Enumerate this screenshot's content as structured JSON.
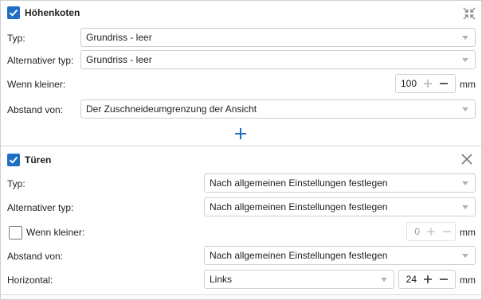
{
  "sections": [
    {
      "title": "Höhenkoten",
      "enabled": true,
      "header_icon": "collapse-icon",
      "typ": {
        "label": "Typ:",
        "value": "Grundriss - leer"
      },
      "alt_typ": {
        "label": "Alternativer typ:",
        "value": "Grundriss - leer"
      },
      "wenn_kleiner": {
        "label": "Wenn kleiner:",
        "value": "100",
        "unit": "mm"
      },
      "abstand": {
        "label": "Abstand von:",
        "value": "Der Zuschneideumgrenzung der Ansicht"
      },
      "add_icon": "plus-icon"
    },
    {
      "title": "Türen",
      "enabled": true,
      "header_icon": "close-icon",
      "typ": {
        "label": "Typ:",
        "value": "Nach allgemeinen Einstellungen festlegen"
      },
      "alt_typ": {
        "label": "Alternativer typ:",
        "value": "Nach allgemeinen Einstellungen festlegen"
      },
      "wenn_kleiner": {
        "label": "Wenn kleiner:",
        "value": "0",
        "unit": "mm",
        "checked": false
      },
      "abstand": {
        "label": "Abstand von:",
        "value": "Nach allgemeinen Einstellungen festlegen"
      },
      "horizontal": {
        "label": "Horizontal:",
        "value": "Links",
        "offset": "24",
        "unit": "mm"
      }
    }
  ],
  "colors": {
    "accent": "#1f6fc5",
    "border": "#cfcfcf",
    "disabled_text": "#9a9a9a"
  }
}
